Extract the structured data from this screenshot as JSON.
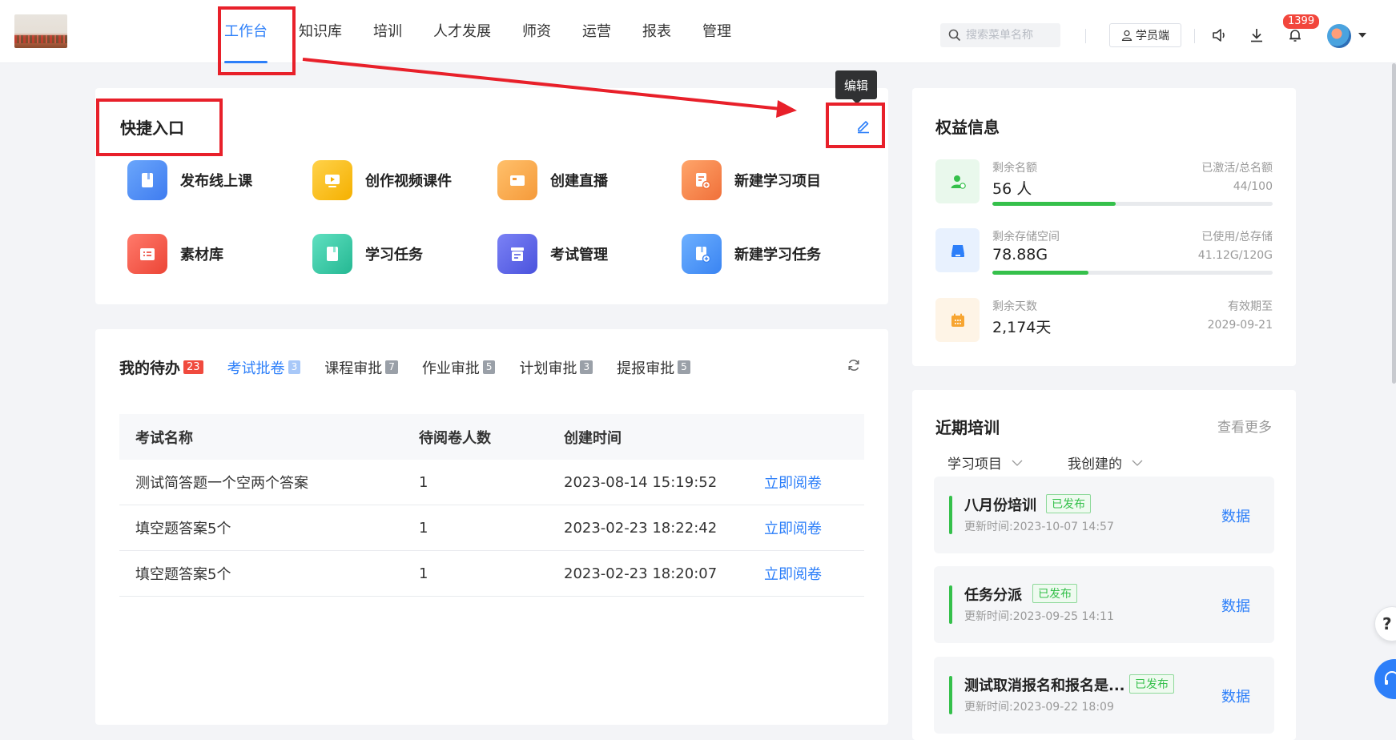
{
  "header": {
    "nav": [
      {
        "label": "工作台",
        "active": true
      },
      {
        "label": "知识库"
      },
      {
        "label": "培训"
      },
      {
        "label": "人才发展"
      },
      {
        "label": "师资"
      },
      {
        "label": "运营"
      },
      {
        "label": "报表"
      },
      {
        "label": "管理"
      }
    ],
    "search_placeholder": "搜索菜单名称",
    "student_label": "学员端",
    "notification_count": "1399",
    "icons": [
      "speaker-icon",
      "download-icon",
      "bell-icon"
    ]
  },
  "quick": {
    "title": "快捷入口",
    "edit_tooltip": "编辑",
    "items": [
      {
        "label": "发布线上课",
        "icon": "book-icon",
        "color": "#4b8ef7"
      },
      {
        "label": "创作视频课件",
        "icon": "video-icon",
        "color": "#f7b500"
      },
      {
        "label": "创建直播",
        "icon": "camera-icon",
        "color": "#f5a04a"
      },
      {
        "label": "新建学习项目",
        "icon": "project-icon",
        "color": "#f47c3c"
      },
      {
        "label": "素材库",
        "icon": "library-icon",
        "color": "#f25547"
      },
      {
        "label": "学习任务",
        "icon": "task-icon",
        "color": "#34c7a5"
      },
      {
        "label": "考试管理",
        "icon": "exam-icon",
        "color": "#5b63e8"
      },
      {
        "label": "新建学习任务",
        "icon": "new-task-icon",
        "color": "#4c93f5"
      }
    ]
  },
  "todo": {
    "title": "我的待办",
    "total": "23",
    "tabs": [
      {
        "label": "考试批卷",
        "count": "3",
        "active": true
      },
      {
        "label": "课程审批",
        "count": "7"
      },
      {
        "label": "作业审批",
        "count": "5"
      },
      {
        "label": "计划审批",
        "count": "3"
      },
      {
        "label": "提报审批",
        "count": "5"
      }
    ],
    "columns": [
      "考试名称",
      "待阅卷人数",
      "创建时间"
    ],
    "rows": [
      {
        "name": "测试简答题一个空两个答案",
        "count": "1",
        "time": "2023-08-14 15:19:52",
        "action": "立即阅卷"
      },
      {
        "name": "填空题答案5个",
        "count": "1",
        "time": "2023-02-23 18:22:42",
        "action": "立即阅卷"
      },
      {
        "name": "填空题答案5个",
        "count": "1",
        "time": "2023-02-23 18:20:07",
        "action": "立即阅卷"
      }
    ]
  },
  "rights": {
    "title": "权益信息",
    "items": [
      {
        "label": "剩余名额",
        "value": "56 人",
        "right_label": "已激活/总名额",
        "right_value": "44/100",
        "progress": 0.44,
        "icon": "user-icon",
        "color": "#35c04b",
        "bg": "#e9f8ec"
      },
      {
        "label": "剩余存储空间",
        "value": "78.88G",
        "right_label": "已使用/总存储",
        "right_value": "41.12G/120G",
        "progress": 0.343,
        "icon": "storage-icon",
        "color": "#2d7ff9",
        "bg": "#e8f1fe"
      },
      {
        "label": "剩余天数",
        "value": "2,174天",
        "right_label": "有效期至",
        "right_value": "2029-09-21",
        "icon": "calendar-icon",
        "color": "#f7a531",
        "bg": "#fef4e6"
      }
    ]
  },
  "training": {
    "title": "近期培训",
    "more": "查看更多",
    "filters": [
      "学习项目",
      "我创建的"
    ],
    "items": [
      {
        "name": "八月份培训",
        "status": "已发布",
        "updated": "更新时间:2023-10-07 14:57",
        "action": "数据"
      },
      {
        "name": "任务分派",
        "status": "已发布",
        "updated": "更新时间:2023-09-25 14:11",
        "action": "数据"
      },
      {
        "name": "测试取消报名和报名是...",
        "status": "已发布",
        "updated": "更新时间:2023-09-22 18:09",
        "action": "数据"
      }
    ]
  },
  "colors": {
    "accent": "#2d7ff9",
    "annotation": "#e8202a",
    "success": "#35c04b"
  }
}
